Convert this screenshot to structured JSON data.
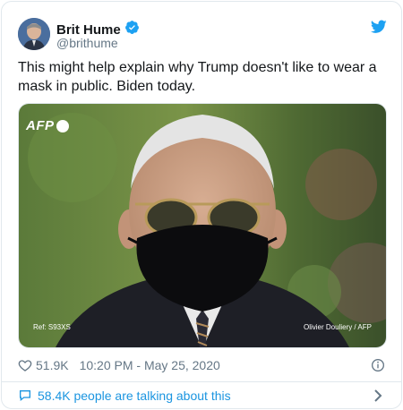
{
  "author": {
    "name": "Brit Hume",
    "handle": "@brithume",
    "verified": true
  },
  "tweet": {
    "text": "This might help explain why Trump doesn't like to wear a mask in public. Biden today."
  },
  "media": {
    "watermark": "AFP",
    "ref": "Ref: S93XS",
    "credit": "Olivier Douliery / AFP"
  },
  "stats": {
    "likes": "51.9K",
    "timestamp": "10:20 PM - May 25, 2020"
  },
  "footer": {
    "talking": "58.4K people are talking about this"
  },
  "icons": {
    "verified": "verified-badge-icon",
    "twitter": "twitter-bird-icon",
    "like": "heart-icon",
    "info": "info-icon",
    "reply": "speech-bubble-icon",
    "chevron": "chevron-right-icon"
  },
  "colors": {
    "accent": "#1da1f2",
    "link": "#1b95e0",
    "muted": "#657786"
  }
}
